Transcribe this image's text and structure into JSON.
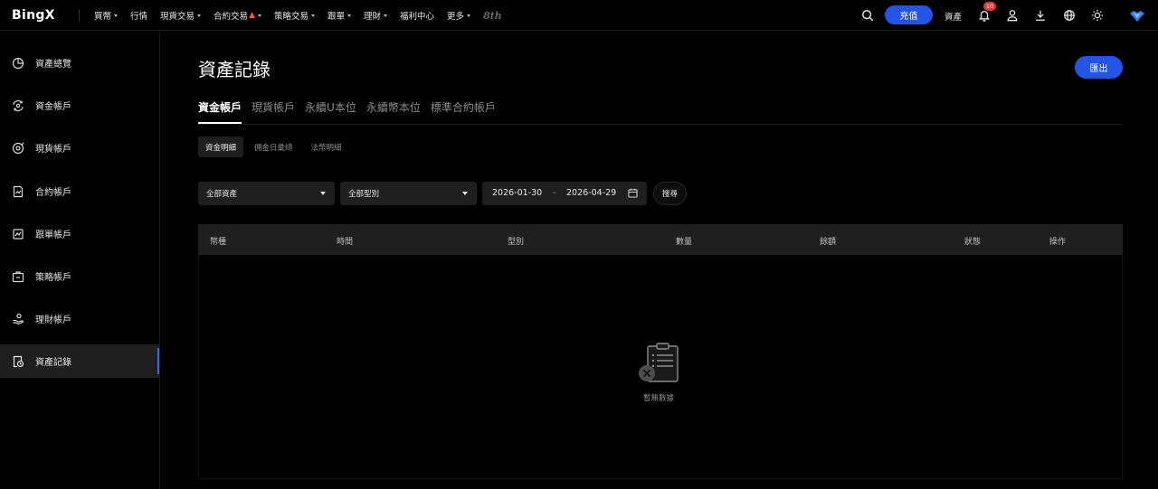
{
  "brand": {
    "logo_text": "BingX",
    "accent": "#2354e6",
    "badge_8th": "8th"
  },
  "topnav": {
    "items": [
      {
        "label": "買幣",
        "dropdown": true
      },
      {
        "label": "行情",
        "dropdown": false
      },
      {
        "label": "現貨交易",
        "dropdown": true
      },
      {
        "label": "合約交易",
        "dropdown": true,
        "hot": true
      },
      {
        "label": "策略交易",
        "dropdown": true
      },
      {
        "label": "跟單",
        "dropdown": true
      },
      {
        "label": "理財",
        "dropdown": true
      },
      {
        "label": "福利中心",
        "dropdown": false
      },
      {
        "label": "更多",
        "dropdown": true
      }
    ],
    "deposit_label": "充值",
    "assets_label": "資產",
    "notification_count": "10",
    "icons": [
      "search-icon",
      "bell-icon",
      "user-icon",
      "download-icon",
      "globe-icon",
      "theme-sun-icon",
      "avatar"
    ]
  },
  "sidebar": {
    "items": [
      {
        "label": "資產總覽",
        "icon": "pie-chart-icon",
        "active": false
      },
      {
        "label": "資金帳戶",
        "icon": "fund-transfer-icon",
        "active": false
      },
      {
        "label": "現貨帳戶",
        "icon": "spot-coin-icon",
        "active": false
      },
      {
        "label": "合約帳戶",
        "icon": "contract-doc-icon",
        "active": false
      },
      {
        "label": "跟單帳戶",
        "icon": "copy-trade-icon",
        "active": false
      },
      {
        "label": "策略帳戶",
        "icon": "strategy-bag-icon",
        "active": false
      },
      {
        "label": "理財帳戶",
        "icon": "wealth-hand-icon",
        "active": false
      },
      {
        "label": "資產記錄",
        "icon": "record-clock-icon",
        "active": true
      }
    ]
  },
  "main": {
    "title": "資產記錄",
    "export_label": "匯出",
    "tabs": [
      {
        "label": "資金帳戶",
        "active": true
      },
      {
        "label": "現貨帳戶",
        "active": false
      },
      {
        "label": "永續U本位",
        "active": false
      },
      {
        "label": "永續幣本位",
        "active": false
      },
      {
        "label": "標準合約帳戶",
        "active": false
      }
    ],
    "subtabs": [
      {
        "label": "資金明細",
        "active": true
      },
      {
        "label": "佣金日彙總",
        "active": false
      },
      {
        "label": "法幣明細",
        "active": false
      }
    ],
    "filters": {
      "asset_select": "全部資產",
      "type_select": "全部型別",
      "date_from": "2026-01-30",
      "date_sep": "-",
      "date_to": "2026-04-29",
      "search_label": "搜尋"
    },
    "table": {
      "columns": [
        "幣種",
        "時間",
        "型別",
        "數量",
        "餘額",
        "狀態",
        "操作"
      ],
      "rows": [],
      "empty_text": "暫無數據"
    }
  }
}
